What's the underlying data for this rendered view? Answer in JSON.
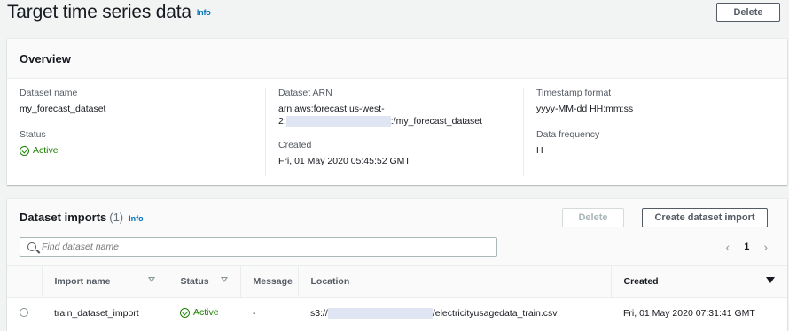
{
  "page": {
    "title": "Target time series data",
    "info": "Info",
    "delete_label": "Delete"
  },
  "overview": {
    "title": "Overview",
    "dataset_name_label": "Dataset name",
    "dataset_name": "my_forecast_dataset",
    "status_label": "Status",
    "status": "Active",
    "arn_label": "Dataset ARN",
    "arn_line1": "arn:aws:forecast:us-west-",
    "arn_line2_prefix": "2:",
    "arn_line2_suffix": ":/my_forecast_dataset",
    "created_label": "Created",
    "created": "Fri, 01 May 2020 05:45:52 GMT",
    "timestamp_label": "Timestamp format",
    "timestamp": "yyyy-MM-dd HH:mm:ss",
    "frequency_label": "Data frequency",
    "frequency": "H"
  },
  "imports": {
    "title": "Dataset imports",
    "count": "(1)",
    "info": "Info",
    "delete_label": "Delete",
    "create_label": "Create dataset import",
    "search_placeholder": "Find dataset name",
    "page": "1",
    "columns": [
      "Import name",
      "Status",
      "Message",
      "Location",
      "Created"
    ],
    "rows": [
      {
        "name": "train_dataset_import",
        "status": "Active",
        "message": "-",
        "location_prefix": "s3://",
        "location_suffix": "/electricityusagedata_train.csv",
        "created": "Fri, 01 May 2020 07:31:41 GMT"
      }
    ]
  }
}
